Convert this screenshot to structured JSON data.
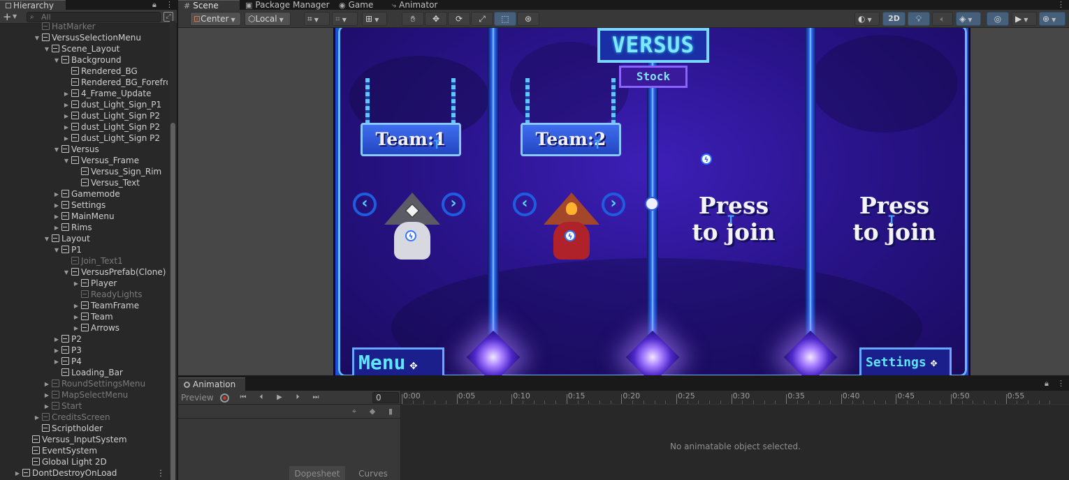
{
  "hierarchy": {
    "tab_label": "Hierarchy",
    "search_placeholder": "All",
    "items": [
      {
        "label": "HatMarker",
        "indent": 4,
        "arrow": "",
        "dim": true
      },
      {
        "label": "VersusSelectionMenu",
        "indent": 4,
        "arrow": "▼",
        "dim": false
      },
      {
        "label": "Scene_Layout",
        "indent": 5,
        "arrow": "▼",
        "dim": false
      },
      {
        "label": "Background",
        "indent": 6,
        "arrow": "▼",
        "dim": false
      },
      {
        "label": "Rendered_BG",
        "indent": 7,
        "arrow": "",
        "dim": false
      },
      {
        "label": "Rendered_BG_Forefront",
        "indent": 7,
        "arrow": "",
        "dim": false
      },
      {
        "label": "4_Frame_Update",
        "indent": 7,
        "arrow": "▶",
        "dim": false
      },
      {
        "label": "dust_Light_Sign_P1",
        "indent": 7,
        "arrow": "▶",
        "dim": false
      },
      {
        "label": "dust_Light_Sign P2",
        "indent": 7,
        "arrow": "▶",
        "dim": false
      },
      {
        "label": "dust_Light_Sign P2",
        "indent": 7,
        "arrow": "▶",
        "dim": false
      },
      {
        "label": "dust_Light_Sign P2",
        "indent": 7,
        "arrow": "▶",
        "dim": false
      },
      {
        "label": "Versus",
        "indent": 6,
        "arrow": "▼",
        "dim": false
      },
      {
        "label": "Versus_Frame",
        "indent": 7,
        "arrow": "▼",
        "dim": false
      },
      {
        "label": "Versus_Sign_Rim",
        "indent": 8,
        "arrow": "",
        "dim": false
      },
      {
        "label": "Versus_Text",
        "indent": 8,
        "arrow": "",
        "dim": false
      },
      {
        "label": "Gamemode",
        "indent": 6,
        "arrow": "▶",
        "dim": false
      },
      {
        "label": "Settings",
        "indent": 6,
        "arrow": "▶",
        "dim": false
      },
      {
        "label": "MainMenu",
        "indent": 6,
        "arrow": "▶",
        "dim": false
      },
      {
        "label": "Rims",
        "indent": 6,
        "arrow": "▶",
        "dim": false
      },
      {
        "label": "Layout",
        "indent": 5,
        "arrow": "▼",
        "dim": false
      },
      {
        "label": "P1",
        "indent": 6,
        "arrow": "▼",
        "dim": false
      },
      {
        "label": "Join_Text1",
        "indent": 7,
        "arrow": "",
        "dim": true
      },
      {
        "label": "VersusPrefab(Clone)",
        "indent": 7,
        "arrow": "▼",
        "dim": false
      },
      {
        "label": "Player",
        "indent": 8,
        "arrow": "▶",
        "dim": false
      },
      {
        "label": "ReadyLights",
        "indent": 8,
        "arrow": "",
        "dim": true
      },
      {
        "label": "TeamFrame",
        "indent": 8,
        "arrow": "▶",
        "dim": false
      },
      {
        "label": "Team",
        "indent": 8,
        "arrow": "▶",
        "dim": false
      },
      {
        "label": "Arrows",
        "indent": 8,
        "arrow": "▶",
        "dim": false
      },
      {
        "label": "P2",
        "indent": 6,
        "arrow": "▶",
        "dim": false
      },
      {
        "label": "P3",
        "indent": 6,
        "arrow": "▶",
        "dim": false
      },
      {
        "label": "P4",
        "indent": 6,
        "arrow": "▶",
        "dim": false
      },
      {
        "label": "Loading_Bar",
        "indent": 6,
        "arrow": "",
        "dim": false
      },
      {
        "label": "RoundSettingsMenu",
        "indent": 5,
        "arrow": "▶",
        "dim": true
      },
      {
        "label": "MapSelectMenu",
        "indent": 5,
        "arrow": "▶",
        "dim": true
      },
      {
        "label": "Start",
        "indent": 5,
        "arrow": "▶",
        "dim": true
      },
      {
        "label": "CreditsScreen",
        "indent": 4,
        "arrow": "▶",
        "dim": true
      },
      {
        "label": "Scriptholder",
        "indent": 4,
        "arrow": "",
        "dim": false
      },
      {
        "label": "Versus_InputSystem",
        "indent": 3,
        "arrow": "",
        "dim": false
      },
      {
        "label": "EventSystem",
        "indent": 3,
        "arrow": "",
        "dim": false
      },
      {
        "label": "Global Light 2D",
        "indent": 3,
        "arrow": "",
        "dim": false
      },
      {
        "label": "DontDestroyOnLoad",
        "indent": 2,
        "arrow": "▶",
        "dim": false
      }
    ]
  },
  "scene": {
    "tabs": [
      {
        "label": "Scene",
        "icon": "#",
        "active": true
      },
      {
        "label": "Package Manager",
        "icon": "▣",
        "active": false
      },
      {
        "label": "Game",
        "icon": "◉",
        "active": false
      },
      {
        "label": "Animator",
        "icon": "⤷",
        "active": false
      }
    ],
    "toolbar": {
      "pivot": "Center",
      "space": "Local",
      "mode_2d": "2D"
    },
    "game": {
      "title": "VERSUS",
      "stock": "Stock",
      "team1": "Team:1",
      "team2": "Team:2",
      "press1": "Press",
      "join1": "to join",
      "press2": "Press",
      "join2": "to join",
      "menu": "Menu",
      "settings": "Settings",
      "colors": {
        "bg": "#2a148c",
        "frame": "#1c4fd6",
        "accent": "#7ee6ff"
      }
    }
  },
  "animation": {
    "tab_label": "Animation",
    "preview": "Preview",
    "frame": "0",
    "timeline": [
      "0:00",
      "0:05",
      "0:10",
      "0:15",
      "0:20",
      "0:25",
      "0:30",
      "0:35",
      "0:40",
      "0:45",
      "0:50",
      "0:55"
    ],
    "message": "No animatable object selected.",
    "dopesheet": "Dopesheet",
    "curves": "Curves"
  }
}
